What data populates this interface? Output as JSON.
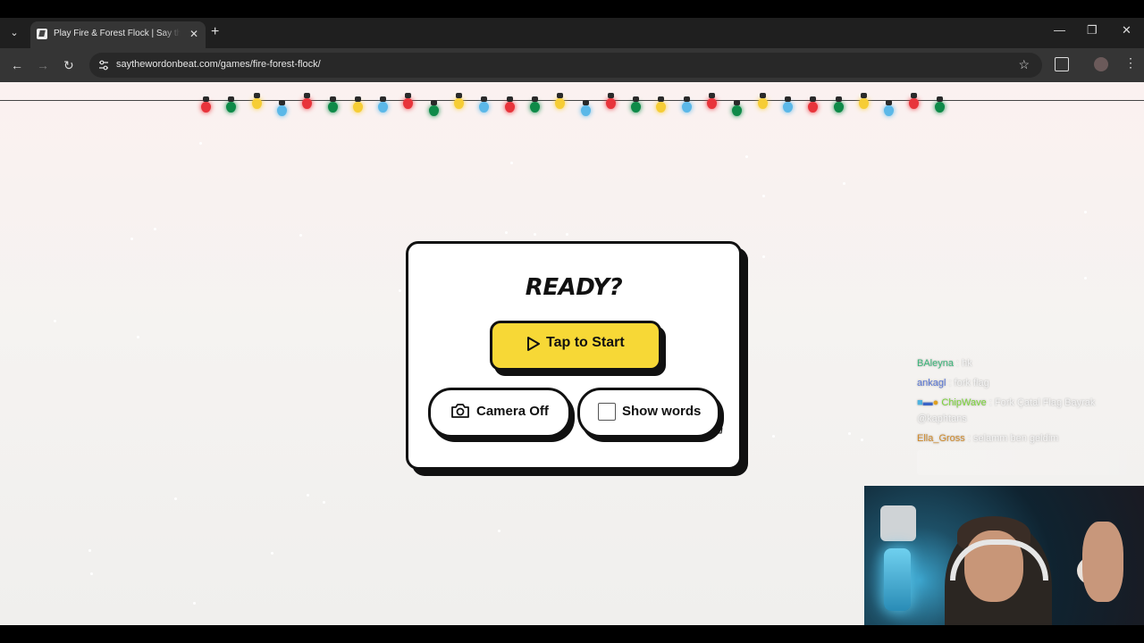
{
  "browser": {
    "tab_title": "Play Fire & Forest Flock | Say the Word on Beat",
    "url": "saythewordonbeat.com/games/fire-forest-flock/"
  },
  "dialog": {
    "heading": "READY?",
    "start_label": "Tap to Start",
    "camera_label": "Camera Off",
    "show_words_label": "Show words"
  },
  "chat": [
    {
      "user": "BAleyna",
      "sep": " : ",
      "message": "hk"
    },
    {
      "user": "ankagl",
      "sep": " : ",
      "message": "fork flag"
    },
    {
      "user": "ChipWave",
      "sep": " : ",
      "message": "Fork Çatal Flag Bayrak @kaphtans"
    },
    {
      "user": "Ella_Gross",
      "sep": " : ",
      "message": "selamm ben geldim"
    }
  ],
  "colors": {
    "accent_yellow": "#f7d836",
    "bulb_red": "#e8343b",
    "bulb_green": "#0e8a48",
    "bulb_yellow": "#f6cd35",
    "bulb_blue": "#5bb8e8"
  }
}
